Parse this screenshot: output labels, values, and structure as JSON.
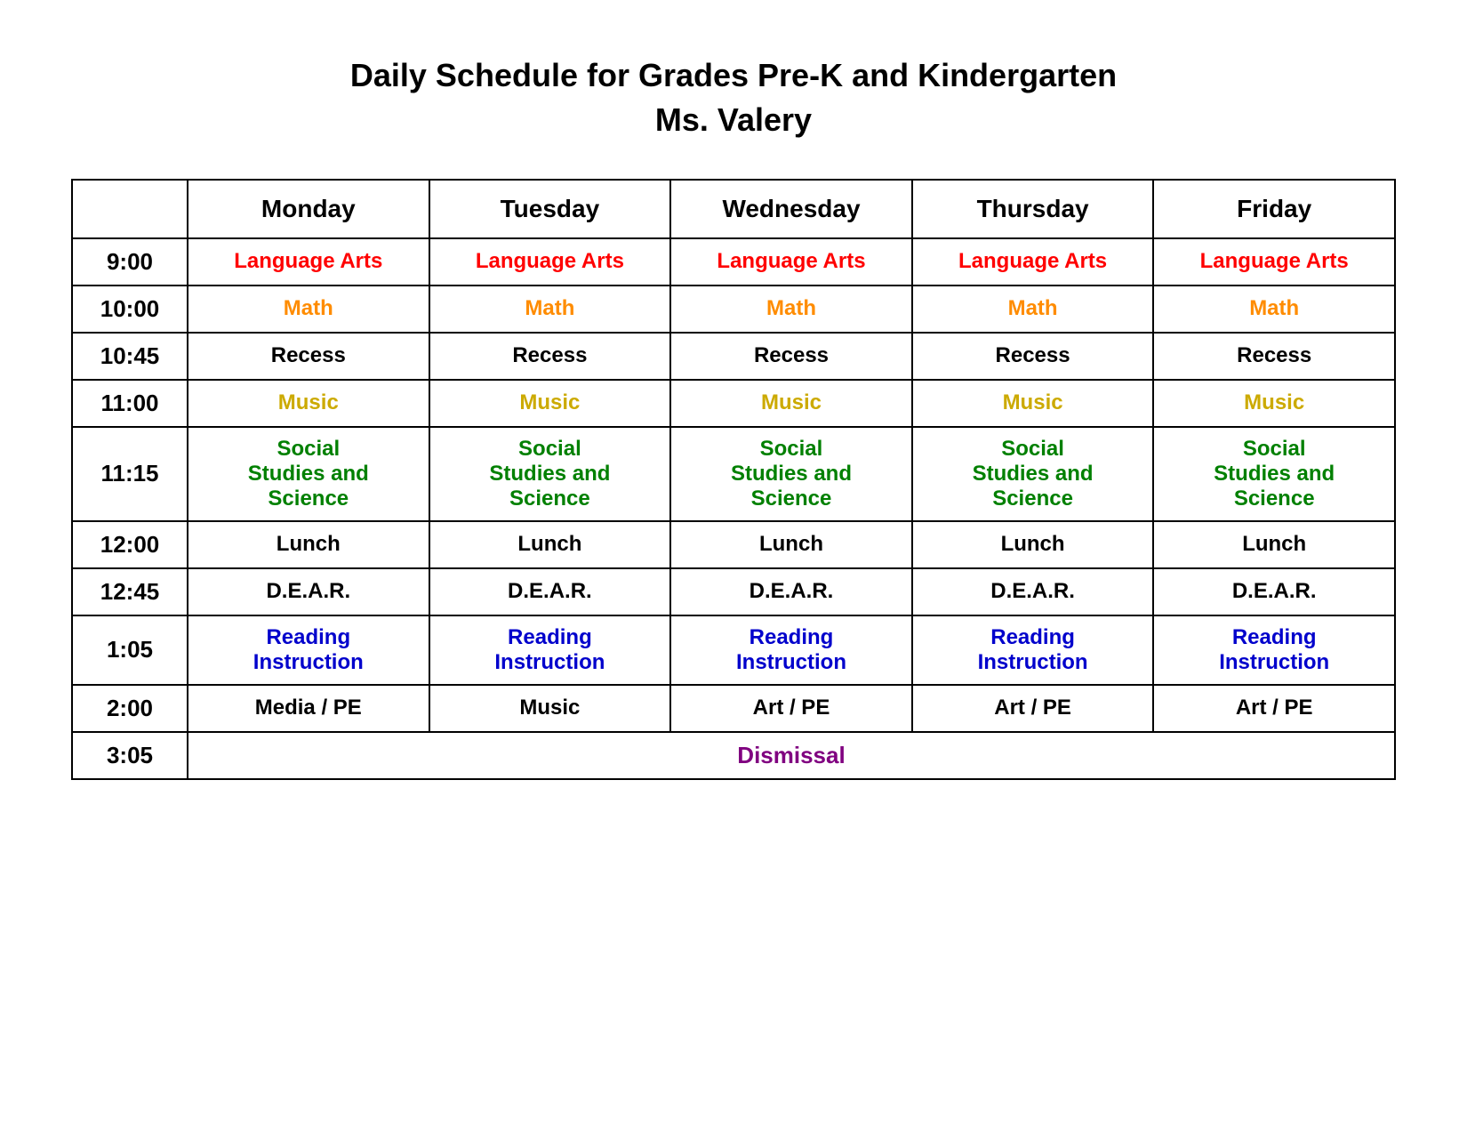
{
  "title": {
    "line1": "Daily Schedule for Grades Pre-K and Kindergarten",
    "line2": "Ms. Valery"
  },
  "headers": {
    "time": "",
    "monday": "Monday",
    "tuesday": "Tuesday",
    "wednesday": "Wednesday",
    "thursday": "Thursday",
    "friday": "Friday"
  },
  "rows": [
    {
      "time": "9:00",
      "subject": "Language Arts",
      "color": "red",
      "colspan": false
    },
    {
      "time": "10:00",
      "subject": "Math",
      "color": "orange",
      "colspan": false
    },
    {
      "time": "10:45",
      "subject": "Recess",
      "color": "black",
      "colspan": false
    },
    {
      "time": "11:00",
      "subject": "Music",
      "color": "yellow",
      "colspan": false
    },
    {
      "time": "11:15",
      "subject": "Social Studies and Science",
      "color": "green",
      "colspan": false,
      "multiline": true
    },
    {
      "time": "12:00",
      "subject": "Lunch",
      "color": "black",
      "colspan": false
    },
    {
      "time": "12:45",
      "subject": "D.E.A.R.",
      "color": "black",
      "colspan": false
    },
    {
      "time": "1:05",
      "subject": "Reading Instruction",
      "color": "blue",
      "colspan": false,
      "multiline": true
    },
    {
      "time": "2:00",
      "cells": [
        "Media / PE",
        "Music",
        "Art / PE",
        "Art / PE",
        "Art / PE"
      ],
      "color": "black",
      "colspan": false,
      "special": true
    },
    {
      "time": "3:05",
      "subject": "Dismissal",
      "color": "purple",
      "colspan": true
    }
  ]
}
